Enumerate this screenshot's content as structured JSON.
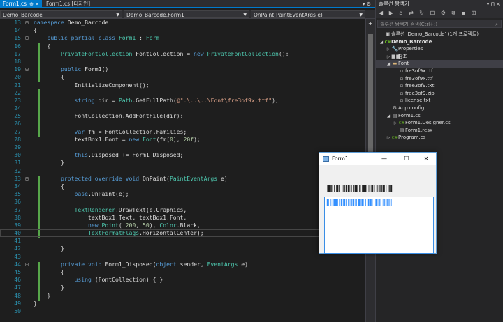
{
  "tabs": [
    {
      "label": "Form1.cs",
      "pin": "⊕ ×"
    },
    {
      "label": "Form1.cs [디자인]",
      "pin": ""
    }
  ],
  "tab_controls": "▾ ⚙",
  "nav": {
    "project": "Demo_Barcode",
    "class": "Demo_Barcode.Form1",
    "member": "OnPaint(PaintEventArgs e)"
  },
  "code_lines": [
    {
      "n": "13",
      "fold": "⊟",
      "segs": [
        [
          "kw",
          "namespace"
        ],
        [
          "pl",
          " Demo_Barcode"
        ]
      ]
    },
    {
      "n": "14",
      "fold": "",
      "segs": [
        [
          "pl",
          "{"
        ]
      ]
    },
    {
      "n": "15",
      "fold": "⊟",
      "segs": [
        [
          "pl",
          "    "
        ],
        [
          "kw",
          "public"
        ],
        [
          "pl",
          " "
        ],
        [
          "kw",
          "partial"
        ],
        [
          "pl",
          " "
        ],
        [
          "kw",
          "class"
        ],
        [
          "pl",
          " "
        ],
        [
          "ty",
          "Form1"
        ],
        [
          "pl",
          " : "
        ],
        [
          "ty",
          "Form"
        ]
      ]
    },
    {
      "n": "16",
      "fold": "",
      "segs": [
        [
          "pl",
          "    {"
        ]
      ]
    },
    {
      "n": "17",
      "fold": "",
      "segs": [
        [
          "pl",
          "        "
        ],
        [
          "ty",
          "PrivateFontCollection"
        ],
        [
          "pl",
          " FontCollection = "
        ],
        [
          "kw",
          "new"
        ],
        [
          "pl",
          " "
        ],
        [
          "ty",
          "PrivateFontCollection"
        ],
        [
          "pl",
          "();"
        ]
      ]
    },
    {
      "n": "18",
      "fold": "",
      "segs": [
        [
          "pl",
          ""
        ]
      ]
    },
    {
      "n": "19",
      "fold": "⊟",
      "segs": [
        [
          "pl",
          "        "
        ],
        [
          "kw",
          "public"
        ],
        [
          "pl",
          " Form1()"
        ]
      ]
    },
    {
      "n": "20",
      "fold": "",
      "segs": [
        [
          "pl",
          "        {"
        ]
      ]
    },
    {
      "n": "21",
      "fold": "",
      "segs": [
        [
          "pl",
          "            InitializeComponent();"
        ]
      ]
    },
    {
      "n": "22",
      "fold": "",
      "segs": [
        [
          "pl",
          ""
        ]
      ]
    },
    {
      "n": "23",
      "fold": "",
      "segs": [
        [
          "pl",
          "            "
        ],
        [
          "kw",
          "string"
        ],
        [
          "pl",
          " dir = "
        ],
        [
          "ty",
          "Path"
        ],
        [
          "pl",
          ".GetFullPath("
        ],
        [
          "st",
          "@\".\\..\\..\\Font\\fre3of9x.ttf\""
        ],
        [
          "pl",
          ");"
        ]
      ]
    },
    {
      "n": "24",
      "fold": "",
      "segs": [
        [
          "pl",
          ""
        ]
      ]
    },
    {
      "n": "25",
      "fold": "",
      "segs": [
        [
          "pl",
          "            FontCollection.AddFontFile(dir);"
        ]
      ]
    },
    {
      "n": "26",
      "fold": "",
      "segs": [
        [
          "pl",
          ""
        ]
      ]
    },
    {
      "n": "27",
      "fold": "",
      "segs": [
        [
          "pl",
          "            "
        ],
        [
          "kw",
          "var"
        ],
        [
          "pl",
          " fm = FontCollection.Families;"
        ]
      ]
    },
    {
      "n": "28",
      "fold": "",
      "segs": [
        [
          "pl",
          "            textBox1.Font = "
        ],
        [
          "kw",
          "new"
        ],
        [
          "pl",
          " "
        ],
        [
          "ty",
          "Font"
        ],
        [
          "pl",
          "(fm["
        ],
        [
          "nu",
          "0"
        ],
        [
          "pl",
          "], "
        ],
        [
          "nu",
          "20f"
        ],
        [
          "pl",
          ");"
        ]
      ]
    },
    {
      "n": "29",
      "fold": "",
      "segs": [
        [
          "pl",
          ""
        ]
      ]
    },
    {
      "n": "30",
      "fold": "",
      "segs": [
        [
          "pl",
          "            "
        ],
        [
          "kw",
          "this"
        ],
        [
          "pl",
          ".Disposed += Form1_Disposed;"
        ]
      ]
    },
    {
      "n": "31",
      "fold": "",
      "segs": [
        [
          "pl",
          "        }"
        ]
      ]
    },
    {
      "n": "32",
      "fold": "",
      "segs": [
        [
          "pl",
          ""
        ]
      ]
    },
    {
      "n": "33",
      "fold": "⊟",
      "segs": [
        [
          "pl",
          "        "
        ],
        [
          "kw",
          "protected"
        ],
        [
          "pl",
          " "
        ],
        [
          "kw",
          "override"
        ],
        [
          "pl",
          " "
        ],
        [
          "kw",
          "void"
        ],
        [
          "pl",
          " OnPaint("
        ],
        [
          "ty",
          "PaintEventArgs"
        ],
        [
          "pl",
          " e)"
        ]
      ]
    },
    {
      "n": "34",
      "fold": "",
      "segs": [
        [
          "pl",
          "        {"
        ]
      ]
    },
    {
      "n": "35",
      "fold": "",
      "segs": [
        [
          "pl",
          "            "
        ],
        [
          "kw",
          "base"
        ],
        [
          "pl",
          ".OnPaint(e);"
        ]
      ]
    },
    {
      "n": "36",
      "fold": "",
      "segs": [
        [
          "pl",
          ""
        ]
      ]
    },
    {
      "n": "37",
      "fold": "",
      "segs": [
        [
          "pl",
          "            "
        ],
        [
          "ty",
          "TextRenderer"
        ],
        [
          "pl",
          ".DrawText(e.Graphics,"
        ]
      ]
    },
    {
      "n": "38",
      "fold": "",
      "segs": [
        [
          "pl",
          "                textBox1.Text, textBox1.Font,"
        ]
      ]
    },
    {
      "n": "39",
      "fold": "",
      "segs": [
        [
          "pl",
          "                "
        ],
        [
          "kw",
          "new"
        ],
        [
          "pl",
          " "
        ],
        [
          "ty",
          "Point"
        ],
        [
          "pl",
          "( "
        ],
        [
          "nu",
          "200"
        ],
        [
          "pl",
          ", "
        ],
        [
          "nu",
          "50"
        ],
        [
          "pl",
          "), "
        ],
        [
          "ty",
          "Color"
        ],
        [
          "pl",
          ".Black,"
        ]
      ]
    },
    {
      "n": "40",
      "fold": "",
      "cur": true,
      "segs": [
        [
          "pl",
          "                "
        ],
        [
          "ty",
          "TextFormatFlags"
        ],
        [
          "pl",
          ".HorizontalCenter);"
        ]
      ]
    },
    {
      "n": "41",
      "fold": "",
      "segs": [
        [
          "pl",
          ""
        ]
      ]
    },
    {
      "n": "42",
      "fold": "",
      "segs": [
        [
          "pl",
          "        }"
        ]
      ]
    },
    {
      "n": "43",
      "fold": "",
      "segs": [
        [
          "pl",
          ""
        ]
      ]
    },
    {
      "n": "44",
      "fold": "⊟",
      "segs": [
        [
          "pl",
          "        "
        ],
        [
          "kw",
          "private"
        ],
        [
          "pl",
          " "
        ],
        [
          "kw",
          "void"
        ],
        [
          "pl",
          " Form1_Disposed("
        ],
        [
          "kw",
          "object"
        ],
        [
          "pl",
          " sender, "
        ],
        [
          "ty",
          "EventArgs"
        ],
        [
          "pl",
          " e)"
        ]
      ]
    },
    {
      "n": "45",
      "fold": "",
      "segs": [
        [
          "pl",
          "        {"
        ]
      ]
    },
    {
      "n": "46",
      "fold": "",
      "segs": [
        [
          "pl",
          "            "
        ],
        [
          "kw",
          "using"
        ],
        [
          "pl",
          " (FontCollection) { }"
        ]
      ]
    },
    {
      "n": "47",
      "fold": "",
      "segs": [
        [
          "pl",
          "        }"
        ]
      ]
    },
    {
      "n": "48",
      "fold": "",
      "segs": [
        [
          "pl",
          "    }"
        ]
      ]
    },
    {
      "n": "49",
      "fold": "",
      "segs": [
        [
          "pl",
          "}"
        ]
      ]
    },
    {
      "n": "50",
      "fold": "",
      "segs": [
        [
          "pl",
          ""
        ]
      ]
    }
  ],
  "solution": {
    "title": "솔루션 탐색기",
    "title_controls": "▾ ⊓ ×",
    "toolbar_icons": "◀ ▶ ⌂ ⇄ ↻ ⊟ ⚙ ⧉ ▪ ⊞",
    "search_placeholder": "솔루션 탐색기 검색(Ctrl+;)",
    "items": [
      {
        "label": "솔루션 'Demo_Barcode' (1개 프로젝트)",
        "exp": "",
        "icon": "▣",
        "indent": 0
      },
      {
        "label": "Demo_Barcode",
        "exp": "◢",
        "icon": "C#",
        "indent": 0,
        "bold": true
      },
      {
        "label": "Properties",
        "exp": "▷",
        "icon": "🔧",
        "indent": 1
      },
      {
        "label": "참조",
        "exp": "▷",
        "icon": "■■",
        "indent": 1
      },
      {
        "label": "Font",
        "exp": "◢",
        "icon": "▬",
        "indent": 1,
        "selected": true
      },
      {
        "label": "fre3of9x.ttf",
        "exp": "",
        "icon": "▫",
        "indent": 2
      },
      {
        "label": "fre3of9x.ttf",
        "exp": "",
        "icon": "▫",
        "indent": 2
      },
      {
        "label": "free3of9.txt",
        "exp": "",
        "icon": "▫",
        "indent": 2
      },
      {
        "label": "free3of9.zip",
        "exp": "",
        "icon": "▫",
        "indent": 2
      },
      {
        "label": "license.txt",
        "exp": "",
        "icon": "▫",
        "indent": 2
      },
      {
        "label": "App.config",
        "exp": "",
        "icon": "⚙",
        "indent": 1
      },
      {
        "label": "Form1.cs",
        "exp": "◢",
        "icon": "▤",
        "indent": 1
      },
      {
        "label": "Form1.Designer.cs",
        "exp": "▷",
        "icon": "C#",
        "indent": 2
      },
      {
        "label": "Form1.resx",
        "exp": "",
        "icon": "▤",
        "indent": 2
      },
      {
        "label": "Program.cs",
        "exp": "▷",
        "icon": "C#",
        "indent": 1
      }
    ]
  },
  "form_window": {
    "title": "Form1",
    "min": "—",
    "max": "☐",
    "close": "✕"
  },
  "colors": {
    "accent": "#007acc",
    "keyword": "#569cd6",
    "type": "#4ec9b0",
    "string": "#d69d85",
    "number": "#b5cea8",
    "line_number": "#2b91af",
    "change_margin": "#57a64a"
  }
}
